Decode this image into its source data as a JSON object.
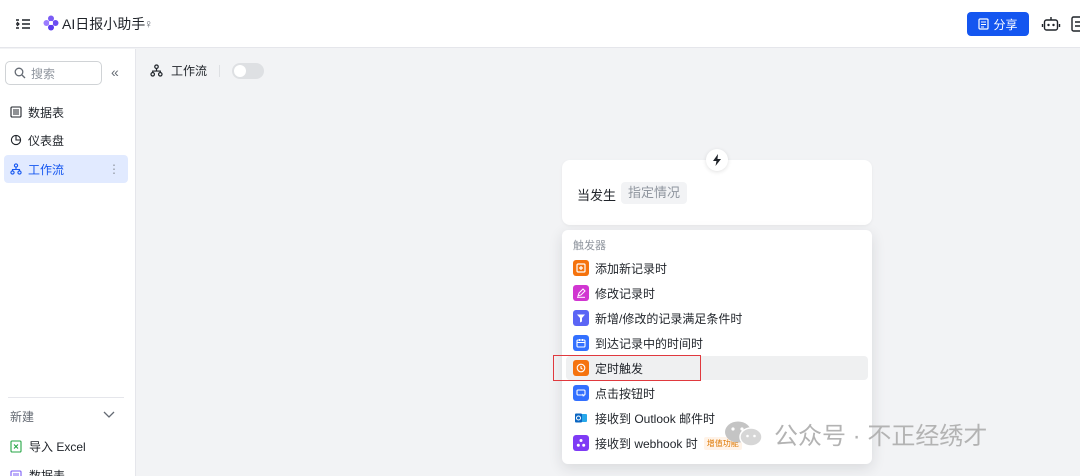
{
  "header": {
    "app_title": "AI日报小助手",
    "pin_glyph": "♀",
    "share_label": "分享"
  },
  "sidebar": {
    "search_placeholder": "搜索",
    "collapse_glyph": "«",
    "items": [
      {
        "label": "数据表"
      },
      {
        "label": "仪表盘"
      },
      {
        "label": "工作流"
      }
    ],
    "more_glyph": "⋮",
    "new_label": "新建",
    "import_excel_label": "导入 Excel",
    "datatable_label": "数据表"
  },
  "main": {
    "workflow_label": "工作流",
    "trigger_card": {
      "when_label": "当发生",
      "condition_placeholder": "指定情况"
    },
    "dropdown": {
      "title": "触发器",
      "items": [
        {
          "label": "添加新记录时",
          "color": "#f5730e"
        },
        {
          "label": "修改记录时",
          "color": "#d136d1"
        },
        {
          "label": "新增/修改的记录满足条件时",
          "color": "#5b65f5"
        },
        {
          "label": "到达记录中的时间时",
          "color": "#3370ff"
        },
        {
          "label": "定时触发",
          "color": "#f5730e"
        },
        {
          "label": "点击按钮时",
          "color": "#3370ff"
        },
        {
          "label": "接收到 Outlook 邮件时",
          "color": "#0a66c2"
        },
        {
          "label": "接收到 webhook 时",
          "color": "#7f3bf5",
          "badge": "增值功能"
        }
      ]
    }
  },
  "watermark": {
    "text": "公众号 · 不正经绣才"
  },
  "colors": {
    "accent": "#1456f0",
    "highlight_box": "#e0393e"
  }
}
